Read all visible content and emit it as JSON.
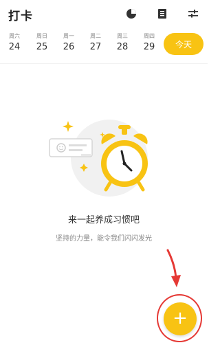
{
  "header": {
    "title": "打卡",
    "icons": [
      "pie-chart-icon",
      "book-icon",
      "sliders-icon"
    ]
  },
  "week": {
    "days": [
      {
        "dow": "周六",
        "num": "24"
      },
      {
        "dow": "周日",
        "num": "25"
      },
      {
        "dow": "周一",
        "num": "26"
      },
      {
        "dow": "周二",
        "num": "27"
      },
      {
        "dow": "周三",
        "num": "28"
      },
      {
        "dow": "周四",
        "num": "29"
      }
    ],
    "today_label": "今天"
  },
  "empty": {
    "title": "来一起养成习惯吧",
    "subtitle": "坚持的力量，能令我们闪闪发光"
  },
  "fab": {
    "label": "+"
  },
  "colors": {
    "accent": "#f8c313",
    "annotation": "#e53935"
  }
}
